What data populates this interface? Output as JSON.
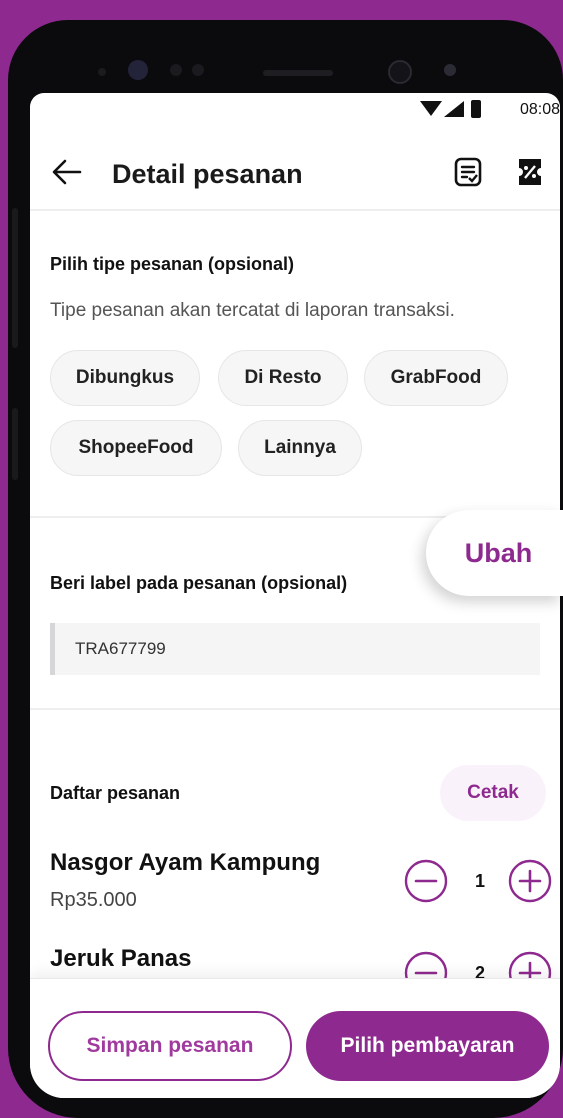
{
  "status_bar": {
    "time": "08:08"
  },
  "header": {
    "title": "Detail pesanan"
  },
  "order_type": {
    "heading": "Pilih tipe pesanan (opsional)",
    "subtitle": "Tipe pesanan akan tercatat di laporan transaksi.",
    "options": [
      "Dibungkus",
      "Di Resto",
      "GrabFood",
      "ShopeeFood",
      "Lainnya"
    ]
  },
  "order_label": {
    "heading": "Beri label pada pesanan (opsional)",
    "value": "TRA677799",
    "edit_label": "Ubah"
  },
  "order_list": {
    "heading": "Daftar pesanan",
    "print_label": "Cetak",
    "items": [
      {
        "name": "Nasgor Ayam Kampung",
        "price": "Rp35.000",
        "qty": "1"
      },
      {
        "name": "Jeruk Panas",
        "price": "",
        "qty": "2"
      }
    ]
  },
  "footer": {
    "save_label": "Simpan pesanan",
    "pay_label": "Pilih pembayaran"
  },
  "colors": {
    "accent": "#8e2a8f",
    "background": "#8e2a8f"
  }
}
